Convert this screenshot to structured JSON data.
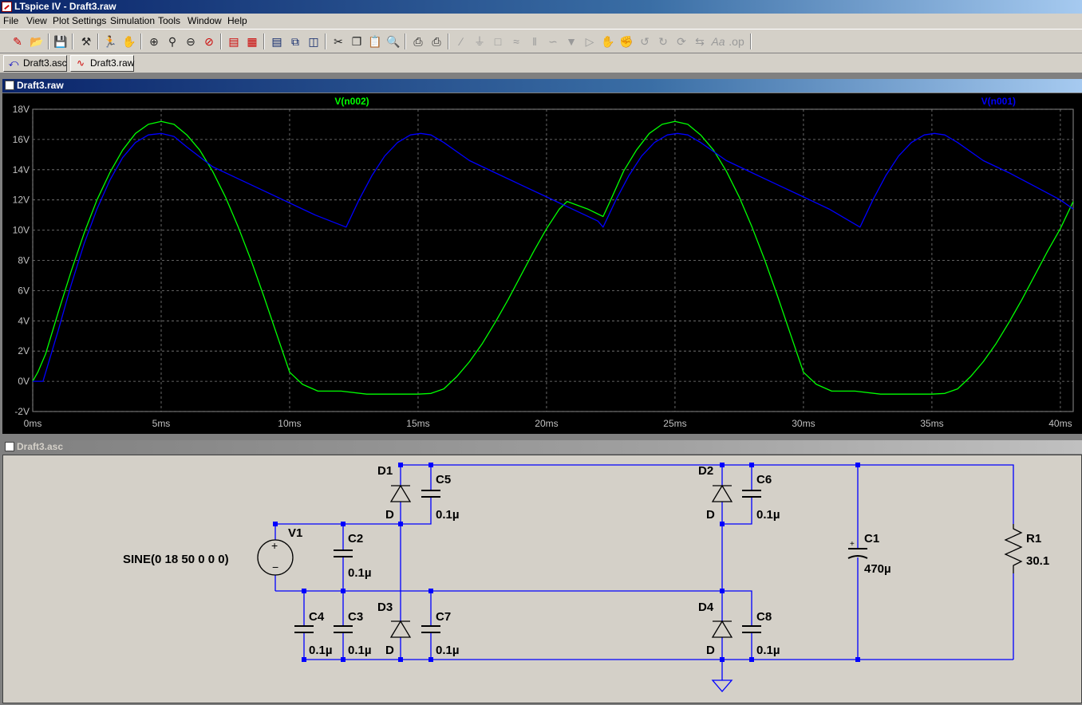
{
  "window": {
    "title": "LTspice IV - Draft3.raw"
  },
  "menu": [
    "File",
    "View",
    "Plot Settings",
    "Simulation",
    "Tools",
    "Window",
    "Help"
  ],
  "toolbar_icons": [
    "new-schematic-icon",
    "open-icon",
    "save-icon",
    "control-panel-icon",
    "run-icon",
    "halt-icon",
    "zoom-in-icon",
    "zoom-out-icon",
    "zoom-fit-icon",
    "cancel-zoom-icon",
    "autorange-icon",
    "plot-settings-icon",
    "tile-horizontal-icon",
    "cascade-icon",
    "tile-vertical-icon",
    "cut-icon",
    "copy-icon",
    "paste-icon",
    "find-icon",
    "print-preview-icon",
    "print-icon",
    "draw-wire-icon",
    "ground-icon",
    "label-net-icon",
    "resistor-icon",
    "capacitor-icon",
    "inductor-icon",
    "diode-icon",
    "component-icon",
    "move-icon",
    "drag-icon",
    "undo-icon",
    "redo-icon",
    "rotate-icon",
    "mirror-icon",
    "text-icon",
    "spice-directive-icon"
  ],
  "tabs": [
    {
      "label": "Draft3.asc",
      "icon": "schematic-icon"
    },
    {
      "label": "Draft3.raw",
      "icon": "waveform-icon"
    }
  ],
  "plot_window": {
    "title": "Draft3.raw"
  },
  "schematic_window": {
    "title": "Draft3.asc"
  },
  "chart_data": {
    "type": "line",
    "xlabel": "",
    "ylabel": "",
    "xlim": [
      0,
      40.5
    ],
    "ylim": [
      -2,
      18
    ],
    "x_ticks": [
      "0ms",
      "5ms",
      "10ms",
      "15ms",
      "20ms",
      "25ms",
      "30ms",
      "35ms",
      "40ms"
    ],
    "x_tick_values": [
      0,
      5,
      10,
      15,
      20,
      25,
      30,
      35,
      40
    ],
    "y_ticks": [
      "18V",
      "16V",
      "14V",
      "12V",
      "10V",
      "8V",
      "6V",
      "4V",
      "2V",
      "0V",
      "-2V"
    ],
    "y_tick_values": [
      18,
      16,
      14,
      12,
      10,
      8,
      6,
      4,
      2,
      0,
      -2
    ],
    "grid": true,
    "series": [
      {
        "name": "V(n002)",
        "color": "#00ff00",
        "x": [
          0,
          0.2,
          0.5,
          1,
          1.5,
          2,
          2.5,
          3,
          3.5,
          4,
          4.5,
          5,
          5.5,
          6,
          6.5,
          7,
          7.5,
          8,
          8.5,
          9,
          9.5,
          10,
          10.5,
          11.1,
          12,
          13,
          14,
          15,
          15.5,
          16,
          16.5,
          17,
          17.5,
          18,
          18.5,
          19,
          19.5,
          20,
          20.5,
          20.8,
          21.6,
          22.2,
          22.5,
          23,
          23.5,
          24,
          24.5,
          25,
          25.5,
          26,
          26.5,
          27,
          27.5,
          28,
          28.5,
          29,
          29.5,
          30,
          30.5,
          31.1,
          32,
          33,
          34,
          35,
          35.5,
          36,
          36.5,
          37,
          37.5,
          38,
          38.5,
          39,
          39.5,
          40,
          40.5
        ],
        "y": [
          0,
          0.6,
          1.8,
          4.6,
          7.3,
          9.8,
          12.0,
          13.8,
          15.3,
          16.4,
          17.0,
          17.2,
          17.0,
          16.3,
          15.3,
          13.9,
          12.2,
          10.2,
          8.0,
          5.6,
          3.1,
          0.6,
          -0.2,
          -0.65,
          -0.65,
          -0.85,
          -0.85,
          -0.85,
          -0.8,
          -0.5,
          0.3,
          1.3,
          2.5,
          3.9,
          5.4,
          7.0,
          8.6,
          10.1,
          11.4,
          11.9,
          11.4,
          10.9,
          12.0,
          13.9,
          15.3,
          16.4,
          17.0,
          17.2,
          17.0,
          16.3,
          15.3,
          13.9,
          12.2,
          10.2,
          8.0,
          5.6,
          3.1,
          0.6,
          -0.2,
          -0.65,
          -0.65,
          -0.85,
          -0.85,
          -0.85,
          -0.8,
          -0.5,
          0.3,
          1.3,
          2.5,
          3.9,
          5.4,
          7.0,
          8.6,
          10.1,
          11.9
        ]
      },
      {
        "name": "V(n001)",
        "color": "#0000ff",
        "x": [
          0,
          0.4,
          1,
          1.5,
          2,
          2.5,
          3,
          3.5,
          4,
          4.5,
          5,
          5.5,
          6,
          7,
          8,
          9,
          10,
          11,
          12.2,
          12.7,
          13.2,
          13.7,
          14.2,
          14.7,
          15.1,
          15.5,
          16,
          17,
          18,
          19,
          20,
          21,
          22,
          22.2,
          22.7,
          23.2,
          23.7,
          24.2,
          24.7,
          25.1,
          25.5,
          26,
          27,
          28,
          29,
          30,
          31,
          32.2,
          32.7,
          33.2,
          33.7,
          34.2,
          34.7,
          35.1,
          35.5,
          36,
          37,
          38,
          39,
          40,
          40.5
        ],
        "y": [
          0,
          0,
          3.4,
          6.4,
          9.1,
          11.4,
          13.3,
          14.8,
          15.8,
          16.3,
          16.4,
          16.2,
          15.5,
          14.2,
          13.4,
          12.6,
          11.8,
          11.0,
          10.2,
          12.0,
          13.6,
          14.9,
          15.8,
          16.3,
          16.4,
          16.3,
          15.8,
          14.6,
          13.8,
          13.0,
          12.2,
          11.4,
          10.6,
          10.2,
          12.0,
          13.6,
          14.9,
          15.8,
          16.3,
          16.4,
          16.3,
          15.8,
          14.6,
          13.8,
          13.0,
          12.2,
          11.4,
          10.2,
          12.0,
          13.6,
          14.9,
          15.8,
          16.3,
          16.4,
          16.3,
          15.8,
          14.6,
          13.8,
          12.9,
          12.0,
          11.4
        ]
      }
    ]
  },
  "schematic": {
    "source": {
      "ref": "V1",
      "value": "SINE(0 18 50 0 0 0)"
    },
    "components": [
      {
        "ref": "D1",
        "model": "D"
      },
      {
        "ref": "D2",
        "model": "D"
      },
      {
        "ref": "D3",
        "model": "D"
      },
      {
        "ref": "D4",
        "model": "D"
      },
      {
        "ref": "C1",
        "value": "470µ"
      },
      {
        "ref": "C2",
        "value": "0.1µ"
      },
      {
        "ref": "C3",
        "value": "0.1µ"
      },
      {
        "ref": "C4",
        "value": "0.1µ"
      },
      {
        "ref": "C5",
        "value": "0.1µ"
      },
      {
        "ref": "C6",
        "value": "0.1µ"
      },
      {
        "ref": "C7",
        "value": "0.1µ"
      },
      {
        "ref": "C8",
        "value": "0.1µ"
      },
      {
        "ref": "R1",
        "value": "30.1"
      }
    ],
    "wire_color": "#0000ff",
    "junction_color": "#0000ff"
  }
}
